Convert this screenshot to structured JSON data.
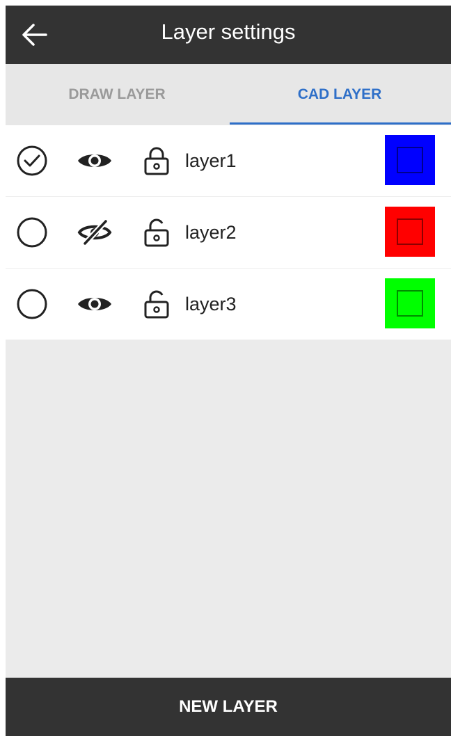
{
  "appbar": {
    "title": "Layer settings",
    "back_icon": "arrow-left-icon"
  },
  "tabs": [
    {
      "label": "DRAW LAYER",
      "active": false
    },
    {
      "label": "CAD LAYER",
      "active": true
    }
  ],
  "accent_color": "#2e6fc8",
  "layers": [
    {
      "name": "layer1",
      "selected": true,
      "visible": true,
      "locked": true,
      "color": "#0000ff"
    },
    {
      "name": "layer2",
      "selected": false,
      "visible": false,
      "locked": false,
      "color": "#ff0000"
    },
    {
      "name": "layer3",
      "selected": false,
      "visible": true,
      "locked": false,
      "color": "#00ff00"
    }
  ],
  "footer": {
    "new_layer_label": "NEW LAYER"
  }
}
